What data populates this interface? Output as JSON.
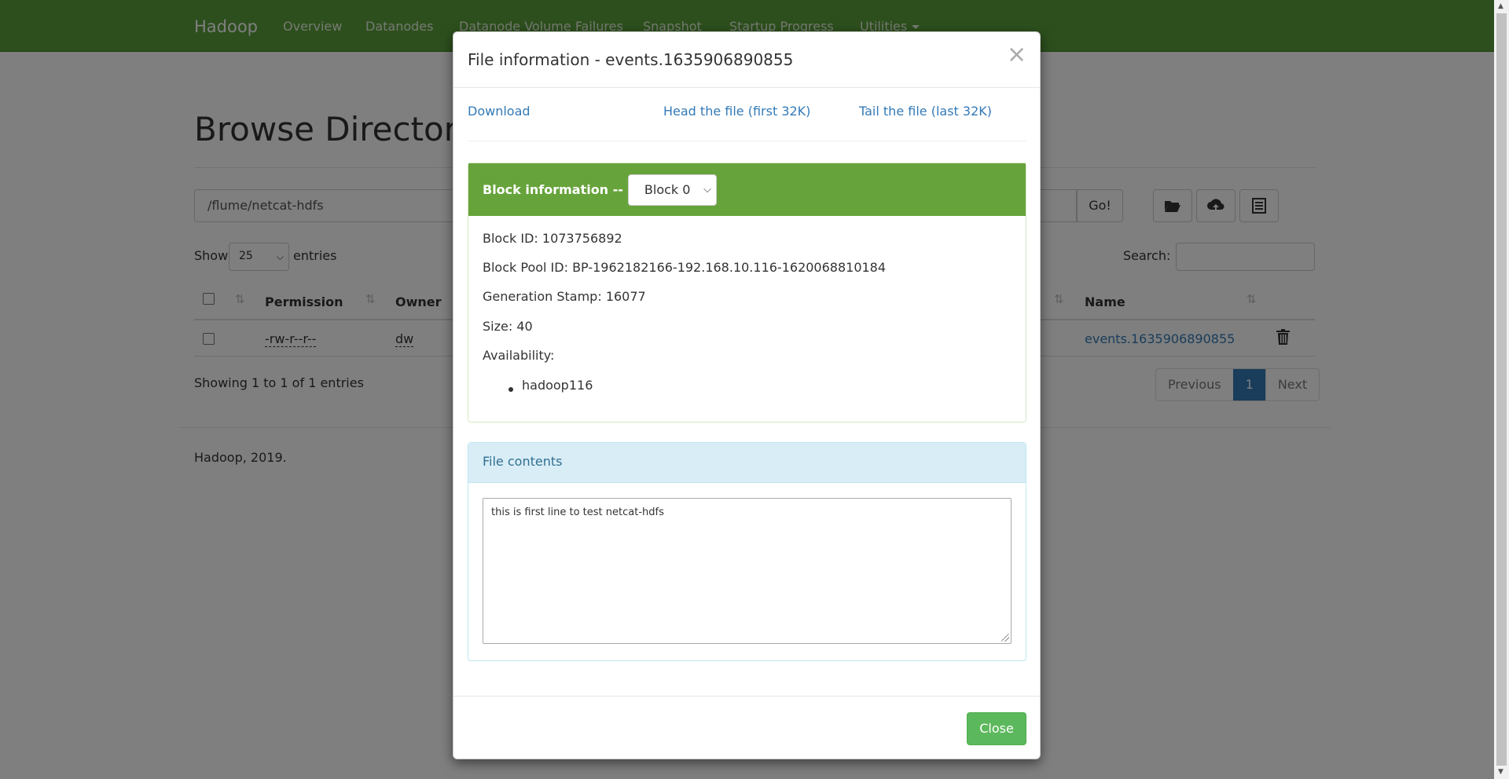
{
  "navbar": {
    "brand": "Hadoop",
    "items": [
      "Overview",
      "Datanodes",
      "Datanode Volume Failures",
      "Snapshot",
      "Startup Progress",
      "Utilities"
    ],
    "color": "#5a9e3a"
  },
  "page": {
    "title": "Browse Directory",
    "path_value": "/flume/netcat-hdfs",
    "go_label": "Go!",
    "show_label": "Show",
    "entries_value": "25",
    "entries_label": "entries",
    "search_label": "Search:",
    "columns": [
      "Permission",
      "Owner",
      "Name"
    ],
    "row": {
      "permission": "-rw-r--r--",
      "owner": "dw",
      "name": "events.1635906890855"
    },
    "showing": "Showing 1 to 1 of 1 entries",
    "pager": {
      "previous": "Previous",
      "current": "1",
      "next": "Next"
    },
    "footer": "Hadoop, 2019."
  },
  "modal": {
    "title": "File information - events.1635906890855",
    "links": {
      "download": "Download",
      "head": "Head the file (first 32K)",
      "tail": "Tail the file (last 32K)"
    },
    "block_panel": {
      "heading": "Block information --",
      "selected_block": "Block 0",
      "block_id_label": "Block ID:",
      "block_id": "1073756892",
      "pool_label": "Block Pool ID:",
      "pool_id": "BP-1962182166-192.168.10.116-1620068810184",
      "gen_label": "Generation Stamp:",
      "gen_stamp": "16077",
      "size_label": "Size:",
      "size": "40",
      "availability_label": "Availability:",
      "availability": [
        "hadoop116"
      ],
      "header_color": "#67a33b"
    },
    "file_panel": {
      "heading": "File contents",
      "content": "this is first line to test netcat-hdfs"
    },
    "close_label": "Close"
  }
}
